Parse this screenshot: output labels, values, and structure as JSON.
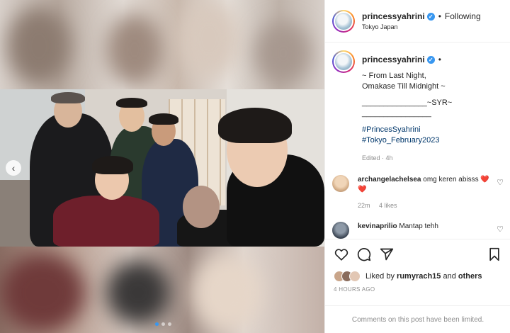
{
  "post": {
    "username": "princessyahrini",
    "separator": "•",
    "follow_state": "Following",
    "location": "Tokyo Japan",
    "caption_separator": "•",
    "caption_lines": [
      "~ From Last Night,",
      "Omakase Till Midnight ~"
    ],
    "signature_line_1": "_______________~SYR~",
    "signature_line_2": "________________",
    "hashtags": [
      "#PrincesSyahrini",
      "#Tokyo_February2023"
    ],
    "caption_meta": "Edited · 4h",
    "carousel_prev_icon": "chevron-left-icon",
    "carousel_dots": 3,
    "carousel_active_index": 0
  },
  "comments": [
    {
      "user": "archangelachelsea",
      "text": "omg keren abisss ❤️❤️",
      "age": "22m",
      "likes": "4 likes",
      "avatar_color": "#d9b48f"
    },
    {
      "user": "kevinaprilio",
      "text": "Mantap tehh",
      "avatar_color": "#3a4452"
    }
  ],
  "actions": {
    "liked_by_prefix": "Liked by",
    "liked_by_user": "rumyrach15",
    "liked_by_conj": "and",
    "liked_by_rest": "others",
    "timestamp": "4 HOURS AGO",
    "limited_notice": "Comments on this post have been limited."
  },
  "colors": {
    "accent": "#3897f0",
    "muted": "#8e8e8e",
    "heart_red": "#e0245e"
  }
}
